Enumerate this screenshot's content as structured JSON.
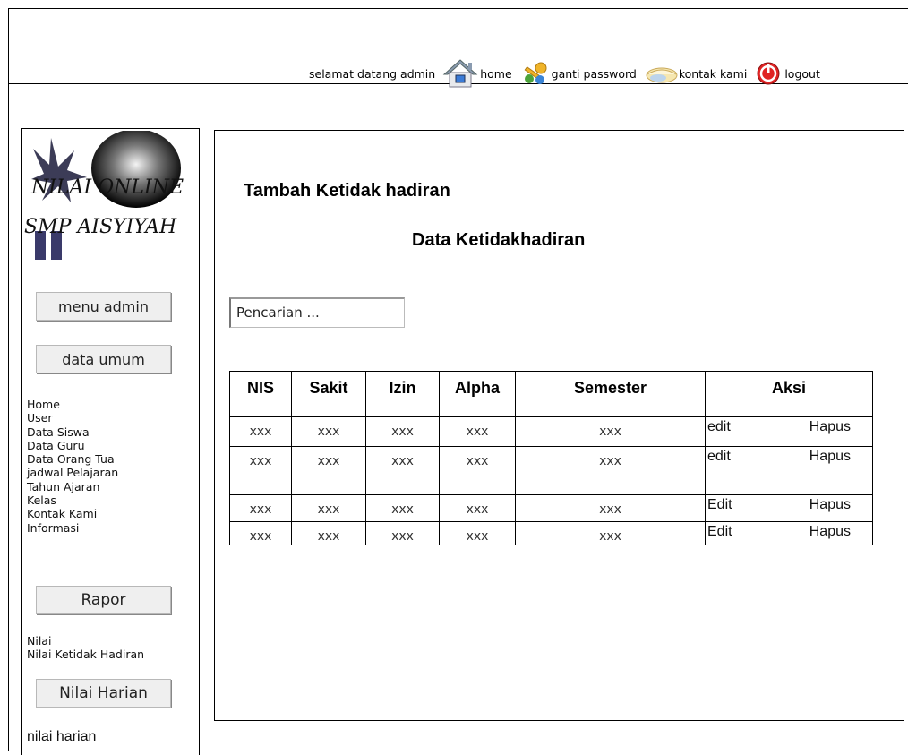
{
  "header": {
    "welcome": "selamat datang admin",
    "home": "home",
    "ganti_password": "ganti password",
    "kontak_kami": "kontak kami",
    "logout": "logout"
  },
  "sidebar": {
    "logo_line1": "NILAI ONLINE",
    "logo_line2": "SMP AISYIYAH",
    "menu_admin": "menu admin",
    "data_umum": "data umum",
    "links": [
      "Home",
      "User",
      "Data Siswa",
      "Data Guru",
      "Data Orang Tua",
      "jadwal Pelajaran",
      "Tahun Ajaran",
      "Kelas",
      "Kontak Kami",
      "Informasi"
    ],
    "rapor": "Rapor",
    "rapor_links": [
      "Nilai",
      "Nilai Ketidak Hadiran"
    ],
    "nilai_harian": "Nilai Harian",
    "nilai_harian_link": "nilai harian"
  },
  "main": {
    "add_title": "Tambah Ketidak hadiran",
    "data_title": "Data Ketidakhadiran",
    "search_placeholder": "Pencarian ...",
    "columns": [
      "NIS",
      "Sakit",
      "Izin",
      "Alpha",
      "Semester",
      "Aksi"
    ],
    "rows": [
      {
        "nis": "xxx",
        "sakit": "xxx",
        "izin": "xxx",
        "alpha": "xxx",
        "semester": "xxx",
        "edit": "edit",
        "hapus": "Hapus"
      },
      {
        "nis": "xxx",
        "sakit": "xxx",
        "izin": "xxx",
        "alpha": "xxx",
        "semester": "xxx",
        "edit": "edit",
        "hapus": "Hapus"
      },
      {
        "nis": "xxx",
        "sakit": "xxx",
        "izin": "xxx",
        "alpha": "xxx",
        "semester": "xxx",
        "edit": "Edit",
        "hapus": "Hapus"
      },
      {
        "nis": "xxx",
        "sakit": "xxx",
        "izin": "xxx",
        "alpha": "xxx",
        "semester": "xxx",
        "edit": "Edit",
        "hapus": "Hapus"
      }
    ]
  },
  "icons": {
    "home": "home-icon",
    "password": "key-users-icon",
    "kontak": "envelope-icon",
    "logout": "power-icon"
  },
  "colors": {
    "home_icon": "#7a8fa6",
    "key_icon": "#e6a817",
    "logout_icon": "#d42020",
    "button_bg": "#efefef"
  }
}
